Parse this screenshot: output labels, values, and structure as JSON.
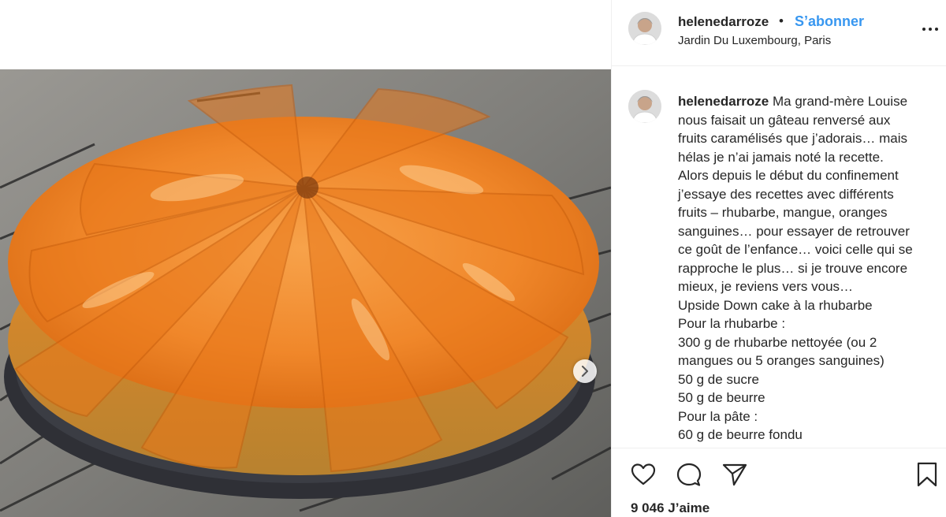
{
  "post": {
    "image_alt": "Upside down cake with caramelized fruit",
    "carousel_icon": "chevron-right-icon"
  },
  "header": {
    "username": "helenedarroze",
    "separator": "•",
    "follow_label": "S’abonner",
    "location": "Jardin Du Luxembourg, Paris",
    "more_icon": "more-options-icon"
  },
  "caption": {
    "username": "helenedarroze",
    "lines": [
      " Ma grand-mère Louise",
      "nous faisait un gâteau renversé aux",
      "fruits caramélisés que j’adorais… mais",
      "hélas je n’ai jamais noté la recette.",
      "Alors depuis le début du confinement",
      "j’essaye des recettes avec différents",
      "fruits – rhubarbe, mangue, oranges",
      "sanguines… pour essayer de retrouver",
      "ce goût de l’enfance… voici celle qui se",
      "rapproche le plus… si je trouve encore",
      "mieux, je reviens vers vous…",
      "Upside Down cake à la rhubarbe",
      "Pour la rhubarbe :",
      "300 g de rhubarbe nettoyée (ou 2",
      "mangues ou 5 oranges sanguines)",
      "50 g de sucre",
      "50 g de beurre",
      "Pour la pâte :",
      "60 g de beurre fondu"
    ]
  },
  "actions": {
    "icons": [
      "heart-icon",
      "comment-icon",
      "share-icon",
      "bookmark-icon"
    ],
    "likes_label": "9 046 J’aime"
  },
  "colors": {
    "link": "#3897f0",
    "text": "#262626",
    "divider": "#efefef"
  }
}
